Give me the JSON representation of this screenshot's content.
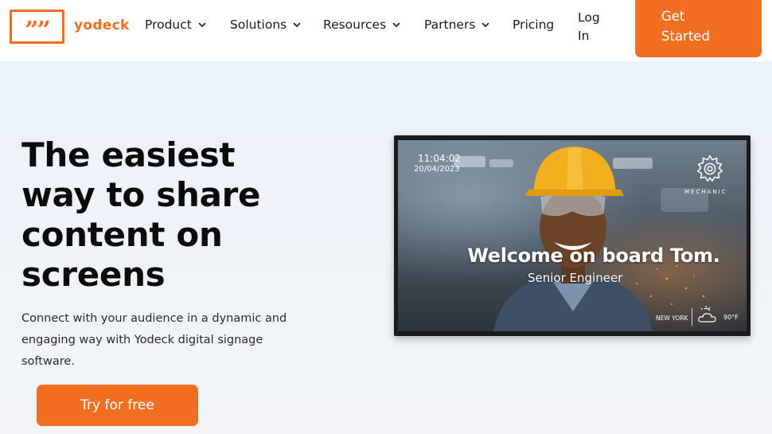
{
  "brand": {
    "logo_mark": "””",
    "name": "yodeck",
    "accent_color": "#f26f21"
  },
  "nav": {
    "items": [
      {
        "label": "Product",
        "icon": "chevron-down-icon"
      },
      {
        "label": "Solutions",
        "icon": "chevron-down-icon"
      },
      {
        "label": "Resources",
        "icon": "chevron-down-icon"
      },
      {
        "label": "Partners",
        "icon": "chevron-down-icon"
      },
      {
        "label": "Pricing"
      }
    ],
    "login_line1": "Log",
    "login_line2": "In",
    "cta_line1": "Get",
    "cta_line2": "Started"
  },
  "hero": {
    "title_lines": [
      "The easiest",
      "way to share",
      "content on",
      "screens"
    ],
    "subtitle_lines": [
      "Connect with your audience in a dynamic and",
      "engaging way with Yodeck digital signage",
      "software."
    ],
    "cta_label": "Try for free"
  },
  "signage_screen": {
    "time": "11:04:02",
    "date": "20/04/2023",
    "department_icon": "gear-icon",
    "department": "MECHANIC",
    "welcome_text": "Welcome on board Tom.",
    "role": "Senior Engineer",
    "city": "NEW YORK",
    "weather_icon": "cloud-sun-icon",
    "temperature": "90°F"
  }
}
